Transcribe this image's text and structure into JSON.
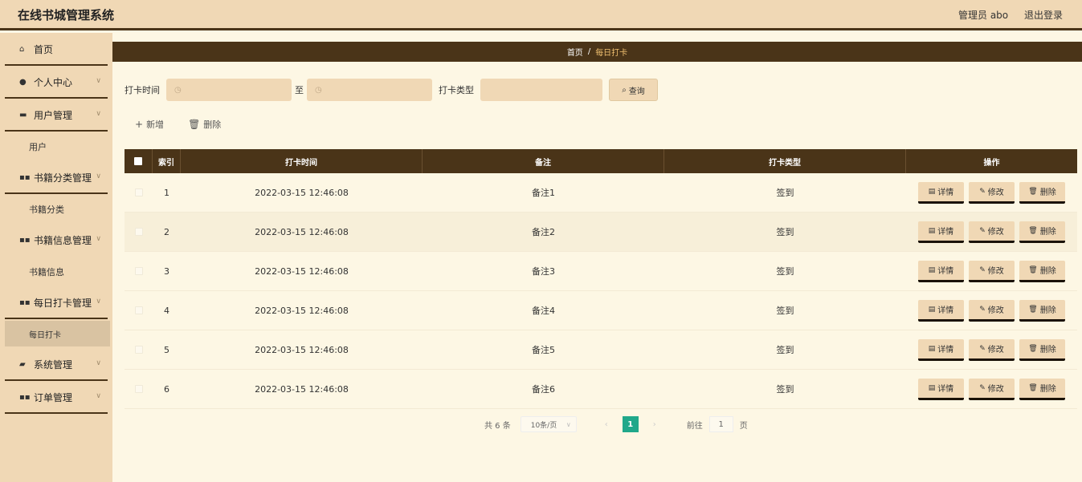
{
  "app": {
    "title": "在线书城管理系统",
    "user": "管理员 abo",
    "logout": "退出登录"
  },
  "sidebar": {
    "home": "首页",
    "personal": "个人中心",
    "user_mgmt": "用户管理",
    "user": "用户",
    "category_mgmt": "书籍分类管理",
    "category": "书籍分类",
    "book_mgmt": "书籍信息管理",
    "book": "书籍信息",
    "checkin_mgmt": "每日打卡管理",
    "checkin": "每日打卡",
    "system_mgmt": "系统管理",
    "order_mgmt": "订单管理"
  },
  "breadcrumb": {
    "home": "首页",
    "sep": "/",
    "current": "每日打卡"
  },
  "search": {
    "time_label": "打卡时间",
    "to": "至",
    "type_label": "打卡类型",
    "button": "查询"
  },
  "actions": {
    "add": "新增",
    "delete": "删除"
  },
  "table": {
    "headers": {
      "index": "索引",
      "time": "打卡时间",
      "note": "备注",
      "type": "打卡类型",
      "ops": "操作"
    },
    "rows": [
      {
        "index": "1",
        "time": "2022-03-15 12:46:08",
        "note": "备注1",
        "type": "签到"
      },
      {
        "index": "2",
        "time": "2022-03-15 12:46:08",
        "note": "备注2",
        "type": "签到"
      },
      {
        "index": "3",
        "time": "2022-03-15 12:46:08",
        "note": "备注3",
        "type": "签到"
      },
      {
        "index": "4",
        "time": "2022-03-15 12:46:08",
        "note": "备注4",
        "type": "签到"
      },
      {
        "index": "5",
        "time": "2022-03-15 12:46:08",
        "note": "备注5",
        "type": "签到"
      },
      {
        "index": "6",
        "time": "2022-03-15 12:46:08",
        "note": "备注6",
        "type": "签到"
      }
    ],
    "ops": {
      "detail": "详情",
      "edit": "修改",
      "delete": "删除"
    }
  },
  "pagination": {
    "total": "共 6 条",
    "page_size": "10条/页",
    "current_page": "1",
    "goto_label": "前往",
    "goto_value": "1",
    "page_unit": "页"
  },
  "colors": {
    "brown_dark": "#4a3418",
    "tan": "#f0d8b5",
    "cream": "#fdf7e4",
    "teal": "#20a88a"
  }
}
